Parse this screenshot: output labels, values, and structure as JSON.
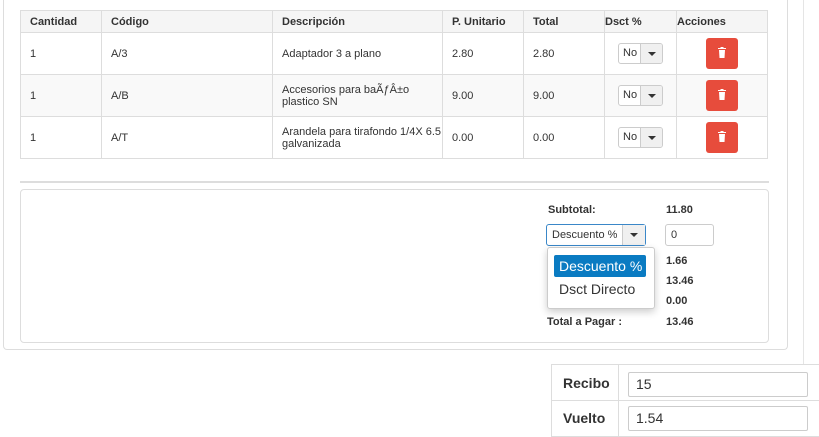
{
  "table": {
    "headers": [
      "Cantidad",
      "Código",
      "Descripción",
      "P. Unitario",
      "Total",
      "Dsct %",
      "Acciones"
    ],
    "rows": [
      {
        "cantidad": "1",
        "codigo": "A/3",
        "descripcion": "Adaptador 3 a plano",
        "unitario": "2.80",
        "total": "2.80",
        "dsct": "No"
      },
      {
        "cantidad": "1",
        "codigo": "A/B",
        "descripcion": "Accesorios para baÃƒÂ±o plastico SN",
        "unitario": "9.00",
        "total": "9.00",
        "dsct": "No"
      },
      {
        "cantidad": "1",
        "codigo": "A/T",
        "descripcion": "Arandela para tirafondo 1/4X 6.5 galvanizada",
        "unitario": "0.00",
        "total": "0.00",
        "dsct": "No"
      }
    ],
    "delete_icon": "trash-icon",
    "delete_color": "#e74c3c"
  },
  "totals": {
    "subtotal_label": "Subtotal:",
    "subtotal_value": "11.80",
    "discount_type_selected": "Descuento %",
    "discount_value": "0",
    "row2_value": "1.66",
    "row3_value": "13.46",
    "row4_value": "0.00",
    "total_label": "Total a Pagar :",
    "total_value": "13.46",
    "dropdown_options": [
      "Descuento %",
      "Dsct Directo"
    ],
    "accent_color": "#0a7bc2"
  },
  "cash": {
    "recibo_label": "Recibo",
    "recibo_value": "15",
    "vuelto_label": "Vuelto",
    "vuelto_value": "1.54"
  }
}
